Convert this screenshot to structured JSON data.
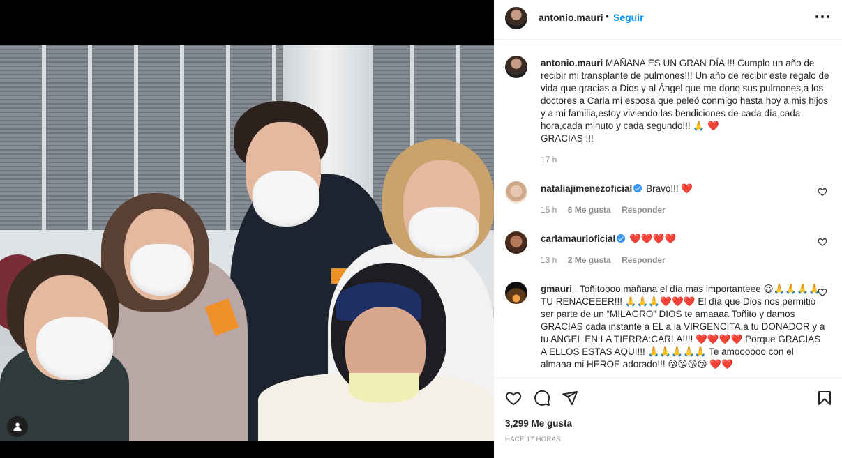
{
  "header": {
    "username": "antonio.mauri",
    "dot": "•",
    "follow_label": "Seguir"
  },
  "caption": {
    "username": "antonio.mauri",
    "text": "MAÑANA ES UN GRAN DÍA !!! Cumplo un año de recibir mi transplante de pulmones!!! Un año de recibir este regalo de vida que gracias a Dios y al Ángel que me dono sus pulmones,a los doctores a Carla mi esposa que peleó conmigo hasta hoy a mis hijos y a mi familia,estoy viviendo las bendiciones de cada día,cada hora,cada minuto y cada segundo!!! 🙏 ❤️",
    "text2": "GRACIAS !!!",
    "time": "17 h"
  },
  "comments": [
    {
      "username": "nataliajimenezoficial",
      "text": "Bravo!!! ❤️",
      "time": "15 h",
      "likes": "6 Me gusta",
      "reply": "Responder"
    },
    {
      "username": "carlamaurioficial",
      "text": "❤️❤️❤️❤️",
      "time": "13 h",
      "likes": "2 Me gusta",
      "reply": "Responder"
    },
    {
      "username": "gmauri_",
      "text": "Toñitoooo mañana el día mas importanteee 😃🙏🙏🙏🙏 TU RENACEEER!!! 🙏🙏🙏❤️❤️❤️ El día que Dios nos permitió ser parte de un “MILAGRO” DIOS te amaaaa Toñito y damos GRACIAS cada instante a EL a la VIRGENCITA,a tu DONADOR y a tu ANGEL EN LA TIERRA:CARLA!!!! ❤️❤️❤️❤️ Porque GRACIAS A ELLOS ESTAS AQUI!!! 🙏🙏🙏🙏🙏 Te amoooooo con el almaaa mi HEROE adorado!!! 😘😘😘😘 ❤️❤️"
    }
  ],
  "actions": {
    "likes": "3,299 Me gusta",
    "posted": "HACE 17 HORAS"
  },
  "icons": [
    "heart-icon",
    "comment-icon",
    "share-icon",
    "save-icon",
    "more-icon",
    "user-tag-icon"
  ],
  "colors": {
    "link": "#0095f6",
    "secondary": "#8e8e8e",
    "verified": "#3897f0"
  }
}
